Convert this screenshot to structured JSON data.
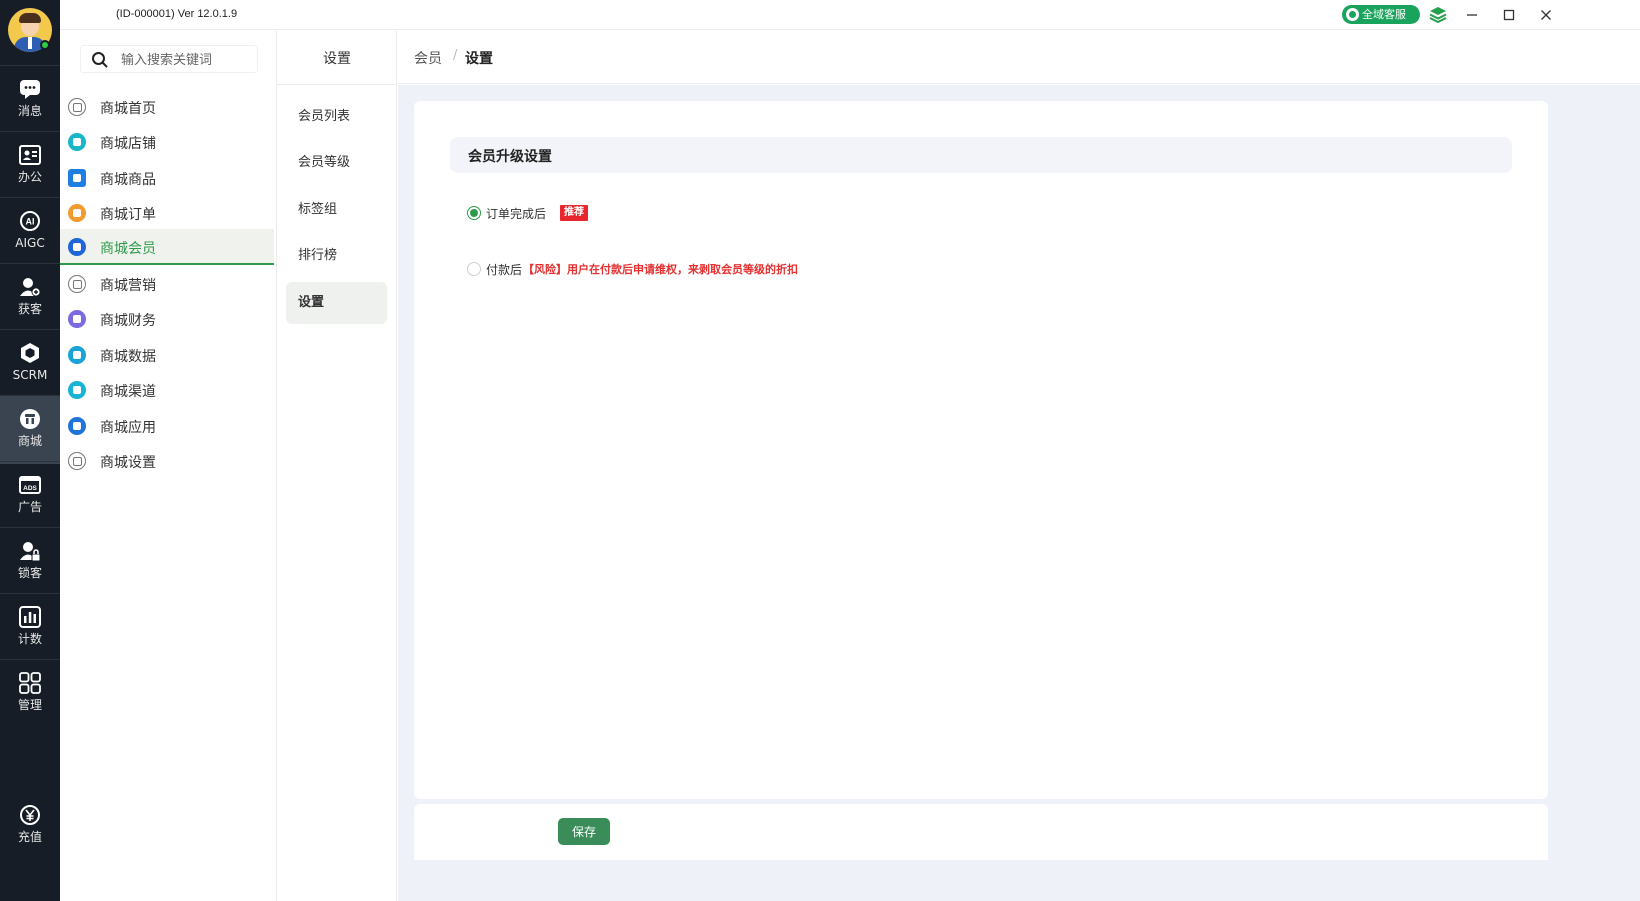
{
  "window": {
    "title": "(ID-000001)  Ver 12.0.1.9",
    "service_label": "全域客服"
  },
  "rail": {
    "items": [
      {
        "label": "消息"
      },
      {
        "label": "办公"
      },
      {
        "label": "AIGC"
      },
      {
        "label": "获客"
      },
      {
        "label": "SCRM"
      },
      {
        "label": "商城"
      },
      {
        "label": "广告"
      },
      {
        "label": "锁客"
      },
      {
        "label": "计数"
      },
      {
        "label": "管理"
      }
    ],
    "recharge_label": "充值",
    "active_index": 5
  },
  "search": {
    "placeholder": "输入搜索关键词"
  },
  "menu": {
    "items": [
      {
        "label": "商城首页",
        "icon": "home-outline-icon",
        "color": "#777777"
      },
      {
        "label": "商城店铺",
        "icon": "cart-icon",
        "color": "#19b6c7"
      },
      {
        "label": "商城商品",
        "icon": "bag-icon",
        "color": "#1f7fe0"
      },
      {
        "label": "商城订单",
        "icon": "order-icon",
        "color": "#f29a2e"
      },
      {
        "label": "商城会员",
        "icon": "members-icon",
        "color": "#1f66d8"
      },
      {
        "label": "商城营销",
        "icon": "marketing-outline-icon",
        "color": "#777777"
      },
      {
        "label": "商城财务",
        "icon": "finance-icon",
        "color": "#7a6be0"
      },
      {
        "label": "商城数据",
        "icon": "data-icon",
        "color": "#19a3d6"
      },
      {
        "label": "商城渠道",
        "icon": "channel-icon",
        "color": "#18b4d6"
      },
      {
        "label": "商城应用",
        "icon": "cloud-search-icon",
        "color": "#1f73d9"
      },
      {
        "label": "商城设置",
        "icon": "cloud-settings-outline-icon",
        "color": "#777777"
      }
    ],
    "active_index": 4,
    "accent": "#2e9b4b"
  },
  "subnav": {
    "title": "设置",
    "items": [
      {
        "label": "会员列表"
      },
      {
        "label": "会员等级"
      },
      {
        "label": "标签组"
      },
      {
        "label": "排行榜"
      },
      {
        "label": "设置"
      }
    ],
    "active_index": 4
  },
  "breadcrumb": {
    "parent": "会员",
    "separator": "/",
    "current": "设置"
  },
  "settings": {
    "section_title": "会员升级设置",
    "options": [
      {
        "label": "订单完成后",
        "badge": "推荐",
        "checked": true
      },
      {
        "label": "付款后",
        "warning": "【风险】用户在付款后申请维权，来剥取会员等级的折扣",
        "checked": false
      }
    ],
    "save_label": "保存"
  }
}
